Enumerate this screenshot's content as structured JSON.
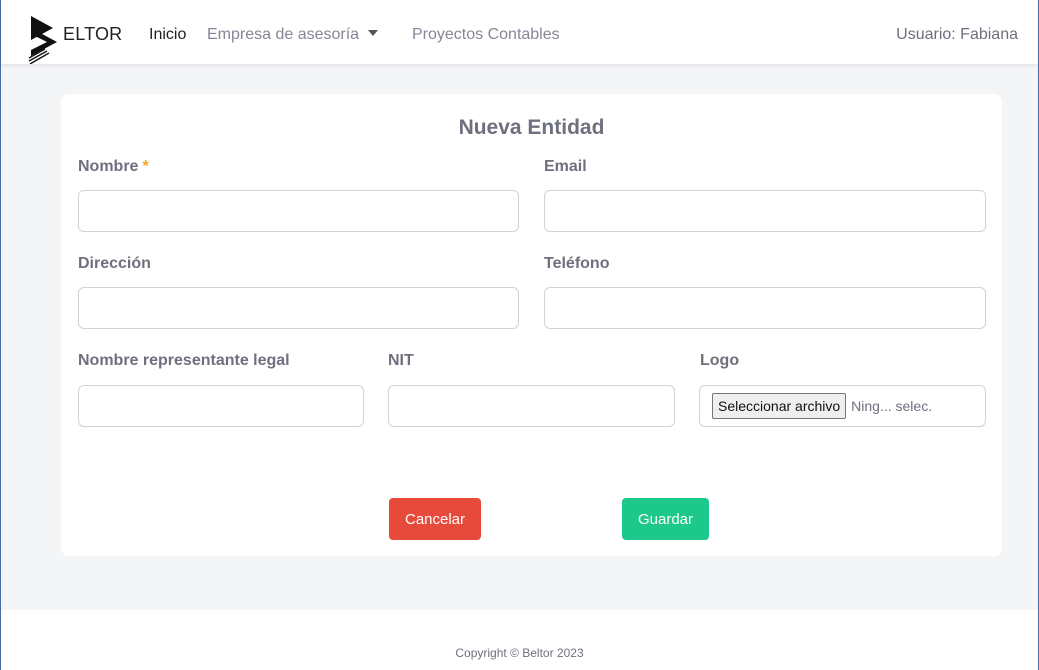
{
  "navbar": {
    "brand": "ELTOR",
    "links": [
      {
        "label": "Inicio"
      },
      {
        "label": "Empresa de asesoría"
      },
      {
        "label": "Proyectos Contables"
      }
    ],
    "user": "Usuario: Fabiana"
  },
  "form": {
    "title": "Nueva Entidad",
    "required_mark": "*",
    "fields": {
      "nombre": {
        "label": "Nombre",
        "value": ""
      },
      "email": {
        "label": "Email",
        "value": ""
      },
      "direccion": {
        "label": "Dirección",
        "value": ""
      },
      "telefono": {
        "label": "Teléfono",
        "value": ""
      },
      "representante": {
        "label": "Nombre representante legal",
        "value": ""
      },
      "nit": {
        "label": "NIT",
        "value": ""
      },
      "logo": {
        "label": "Logo",
        "button": "Seleccionar archivo",
        "status": "Ning... selec."
      }
    },
    "cancel_label": "Cancelar",
    "save_label": "Guardar"
  },
  "footer": {
    "copyright": "Copyright © Beltor 2023"
  },
  "colors": {
    "cancel": "#e74a3b",
    "save": "#1cc88a",
    "required": "#f6a623",
    "border": "#4a6aa8"
  }
}
